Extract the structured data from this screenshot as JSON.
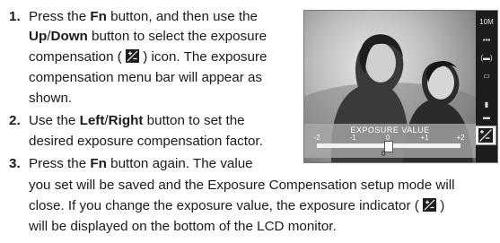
{
  "steps": [
    {
      "number": "1.",
      "line1_pre": "Press the ",
      "line1_bold": "Fn",
      "line1_post": " button, and then use the",
      "line2_bold1": "Up",
      "line2_sep": "/",
      "line2_bold2": "Down",
      "line2_post": " button to select the exposure",
      "line3_pre": "compensation ( ",
      "line3_post": " ) icon. The exposure",
      "line4": "compensation menu bar will appear as",
      "line5": "shown."
    },
    {
      "number": "2.",
      "line1_pre": "Use the ",
      "line1_bold1": "Left",
      "line1_sep": "/",
      "line1_bold2": "Right",
      "line1_post": " button to set the",
      "line2": "desired exposure compensation factor."
    },
    {
      "number": "3.",
      "line1_pre": "Press the ",
      "line1_bold": "Fn",
      "line1_post": " button again. The value",
      "line2": "you set will be saved and the Exposure Compensation setup mode will",
      "line3_pre": "close. If you change the exposure value, the exposure indicator ( ",
      "line3_post": " )",
      "line4": "will be displayed on the bottom of the LCD monitor."
    }
  ],
  "lcd": {
    "ev_title": "EXPOSURE VALUE",
    "ticks": [
      "-2",
      "-1",
      "0",
      "+1",
      "+2"
    ],
    "current_value": "0",
    "side_icons": [
      "image-size-icon",
      "quality-icon",
      "metering-icon",
      "drive-mode-icon",
      "iso-icon",
      "white-balance-icon",
      "exposure-icon"
    ]
  }
}
